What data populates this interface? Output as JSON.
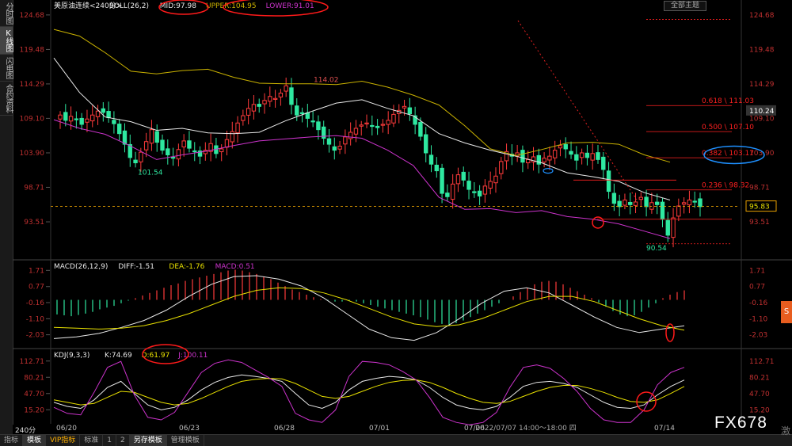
{
  "sidebar": {
    "items": [
      {
        "label": "分时图",
        "active": false
      },
      {
        "label": "K线图",
        "active": true
      },
      {
        "label": "闪电图",
        "active": false
      },
      {
        "label": "合约资料",
        "active": false
      }
    ]
  },
  "header": {
    "dropdown_label": "全部主题"
  },
  "main_legend": {
    "symbol": "美原油连续",
    "period_tag": "<240分>",
    "boll": "BOLL(26,2)",
    "mid": "MID:97.98",
    "upper": "UPPER:104.95",
    "lower": "LOWER:91.01"
  },
  "macd_legend": {
    "name": "MACD(26,12,9)",
    "diff": "DIFF:-1.51",
    "dea": "DEA:-1.76",
    "macd": "MACD:0.51"
  },
  "kdj_legend": {
    "name": "KDJ(9,3,3)",
    "k": "K:74.69",
    "d": "D:61.97",
    "j": "J:100.11"
  },
  "annotations": {
    "high_label": "114.02",
    "low1_label": "101.54",
    "low2_label": "90.54",
    "current_price": "95.83",
    "hover_price": "110.24",
    "timestamp": "2022/07/07 14:00～18:00 四"
  },
  "fib_levels": [
    {
      "ratio": "0.618",
      "price": 111.03,
      "label": "0.618 \\ 111.03"
    },
    {
      "ratio": "0.500",
      "price": 107.1,
      "label": "0.500 \\ 107.10"
    },
    {
      "ratio": "0.382",
      "price": 103.17,
      "label": "0.382 \\ 103.17"
    },
    {
      "ratio": "0.236",
      "price": 98.32,
      "label": "0.236 \\ 98.32"
    }
  ],
  "bottom_tabs": [
    {
      "label": "指标",
      "active": false,
      "vip": false
    },
    {
      "label": "模板",
      "active": true,
      "vip": false
    },
    {
      "label": "VIP指标",
      "active": false,
      "vip": true
    },
    {
      "label": "标准",
      "active": false,
      "vip": false
    },
    {
      "label": "1",
      "active": false,
      "vip": false
    },
    {
      "label": "2",
      "active": false,
      "vip": false
    },
    {
      "label": "另存模板",
      "active": true,
      "vip": false
    },
    {
      "label": "管理模板",
      "active": false,
      "vip": false
    }
  ],
  "period_button": "240分",
  "watermark": "FX678",
  "side_text": "激",
  "side_icon_label": "S",
  "colors": {
    "up": "#ff3b3b",
    "down": "#2ee8a0",
    "mid": "#e8e8e8",
    "upper": "#c9b100",
    "lower": "#cc33cc",
    "fib": "#ff2020",
    "diff": "#e8e8e8",
    "dea": "#e8e000",
    "k": "#e8e8e8",
    "d": "#e8e000",
    "j": "#cc33cc",
    "circle": "#ff1a1a",
    "ellipse_blue": "#1e90ff"
  },
  "chart_data": [
    {
      "type": "candlestick",
      "title": "美原油连续<240分>",
      "x_ticks": [
        "06/20",
        "06/23",
        "06/28",
        "07/01",
        "07/06",
        "07/14"
      ],
      "y_ticks": [
        124.68,
        119.48,
        114.29,
        109.1,
        103.9,
        98.71,
        93.51
      ],
      "ylim": [
        88.5,
        125.5
      ],
      "candles_close": [
        109.6,
        108.8,
        109.4,
        108.9,
        108.2,
        109.0,
        109.6,
        110.2,
        110.0,
        109.2,
        108.3,
        106.8,
        105.2,
        103.2,
        102.4,
        104.0,
        105.6,
        107.4,
        105.5,
        104.3,
        103.6,
        103.1,
        104.4,
        105.7,
        104.6,
        104.1,
        103.4,
        104.3,
        105.3,
        103.8,
        104.5,
        105.9,
        107.1,
        108.4,
        109.5,
        110.6,
        111.2,
        110.9,
        111.8,
        112.4,
        112.1,
        112.9,
        114.0,
        111.2,
        109.6,
        109.8,
        109.1,
        108.6,
        107.4,
        106.1,
        105.2,
        104.3,
        104.9,
        106.3,
        107.0,
        107.6,
        108.1,
        108.4,
        108.0,
        107.7,
        108.2,
        108.8,
        109.7,
        110.3,
        110.9,
        109.8,
        108.2,
        106.4,
        103.9,
        102.2,
        101.2,
        97.8,
        97.3,
        99.2,
        100.6,
        99.8,
        98.4,
        97.9,
        97.4,
        98.9,
        99.6,
        100.4,
        102.6,
        104.1,
        103.4,
        103.9,
        102.5,
        102.9,
        103.3,
        102.2,
        103.1,
        103.4,
        104.3,
        105.0,
        104.5,
        103.7,
        102.8,
        103.9,
        103.2,
        103.8,
        102.9,
        101.4,
        98.1,
        96.3,
        95.8,
        96.8,
        96.1,
        96.5,
        97.2,
        95.8,
        96.4,
        96.1,
        93.9,
        91.5,
        94.1,
        95.9,
        96.4,
        96.8,
        96.6,
        95.8
      ],
      "series": [
        {
          "name": "MID",
          "values": [
            118.2,
            113.0,
            109.3,
            108.6,
            107.3,
            107.6,
            106.9,
            106.8,
            107.0,
            108.7,
            110.1,
            111.4,
            111.9,
            110.6,
            109.5,
            106.8,
            105.4,
            104.3,
            103.4,
            102.4,
            100.9,
            100.3,
            99.6,
            97.9,
            96.8
          ]
        },
        {
          "name": "UPPER",
          "values": [
            122.5,
            121.5,
            119.0,
            116.2,
            115.8,
            116.3,
            116.5,
            115.3,
            114.4,
            114.3,
            114.3,
            114.2,
            114.7,
            113.8,
            112.6,
            111.1,
            108.0,
            104.5,
            103.5,
            104.4,
            105.4,
            105.5,
            105.2,
            103.6,
            102.5
          ]
        },
        {
          "name": "LOWER",
          "values": [
            108.9,
            107.6,
            106.7,
            104.9,
            102.9,
            103.6,
            104.2,
            105.0,
            105.7,
            106.0,
            106.3,
            106.5,
            106.1,
            104.3,
            102.0,
            97.2,
            95.4,
            95.5,
            94.9,
            95.2,
            94.3,
            93.9,
            93.2,
            92.1,
            91.0
          ]
        }
      ]
    },
    {
      "type": "bar",
      "title": "MACD(26,12,9)",
      "y_ticks": [
        1.71,
        0.77,
        -0.16,
        -1.1,
        -2.03
      ],
      "ylim": [
        -2.6,
        2.0
      ],
      "macd_hist": [
        -0.85,
        -0.9,
        -0.95,
        -0.88,
        -0.8,
        -0.7,
        -0.55,
        -0.45,
        -0.35,
        -0.2,
        -0.05,
        0.1,
        0.25,
        0.4,
        0.55,
        0.7,
        0.85,
        0.95,
        1.1,
        1.2,
        1.3,
        1.4,
        1.5,
        1.6,
        1.7,
        1.75,
        1.7,
        1.6,
        1.5,
        1.35,
        1.2,
        1.0,
        0.8,
        0.6,
        0.45,
        0.3,
        0.15,
        0.05,
        -0.05,
        -0.1,
        -0.1,
        -0.05,
        -0.1,
        -0.2,
        -0.3,
        -0.4,
        -0.5,
        -0.6,
        -0.7,
        -0.8,
        -0.9,
        -1.0,
        -1.15,
        -1.3,
        -1.4,
        -1.45,
        -1.35,
        -1.2,
        -1.0,
        -0.8,
        -0.6,
        -0.4,
        -0.2,
        0.0,
        0.2,
        0.45,
        0.7,
        0.9,
        1.05,
        1.1,
        1.05,
        0.9,
        0.7,
        0.5,
        0.3,
        0.1,
        -0.15,
        -0.4,
        -0.65,
        -0.85,
        -0.95,
        -0.9,
        -0.7,
        -0.45,
        -0.2,
        0.1,
        0.3,
        0.45,
        0.55
      ],
      "series": [
        {
          "name": "DIFF",
          "values": [
            -2.25,
            -2.15,
            -1.95,
            -1.6,
            -1.2,
            -0.6,
            0.2,
            0.9,
            1.35,
            1.4,
            1.2,
            0.8,
            0.1,
            -0.8,
            -1.7,
            -2.2,
            -2.35,
            -1.9,
            -1.1,
            -0.2,
            0.5,
            0.7,
            0.4,
            -0.3,
            -1.0,
            -1.6,
            -1.9,
            -1.7,
            -1.51
          ]
        },
        {
          "name": "DEA",
          "values": [
            -1.6,
            -1.65,
            -1.7,
            -1.65,
            -1.5,
            -1.2,
            -0.8,
            -0.3,
            0.2,
            0.55,
            0.7,
            0.65,
            0.4,
            0.0,
            -0.5,
            -1.0,
            -1.4,
            -1.55,
            -1.45,
            -1.1,
            -0.6,
            -0.1,
            0.2,
            0.2,
            -0.1,
            -0.6,
            -1.1,
            -1.5,
            -1.76
          ]
        }
      ]
    },
    {
      "type": "line",
      "title": "KDJ(9,3,3)",
      "y_ticks": [
        112.71,
        80.21,
        47.7,
        15.2
      ],
      "ylim": [
        -5,
        125
      ],
      "series": [
        {
          "name": "K",
          "values": [
            30,
            22,
            18,
            35,
            60,
            72,
            48,
            25,
            15,
            20,
            35,
            55,
            70,
            80,
            85,
            82,
            78,
            72,
            48,
            25,
            18,
            30,
            55,
            72,
            78,
            82,
            80,
            75,
            60,
            40,
            25,
            18,
            15,
            22,
            40,
            62,
            70,
            72,
            68,
            60,
            45,
            30,
            20,
            18,
            25,
            45,
            62,
            74.69
          ]
        },
        {
          "name": "D",
          "values": [
            35,
            30,
            25,
            28,
            40,
            52,
            50,
            40,
            30,
            25,
            28,
            38,
            50,
            62,
            72,
            76,
            78,
            77,
            68,
            55,
            42,
            38,
            42,
            52,
            62,
            70,
            74,
            75,
            70,
            60,
            48,
            38,
            30,
            28,
            32,
            42,
            52,
            60,
            64,
            64,
            58,
            50,
            40,
            32,
            30,
            35,
            48,
            61.97
          ]
        },
        {
          "name": "J",
          "values": [
            20,
            8,
            5,
            50,
            100,
            112,
            45,
            0,
            -5,
            10,
            50,
            90,
            108,
            115,
            110,
            95,
            80,
            62,
            8,
            -5,
            -10,
            15,
            82,
            112,
            110,
            105,
            92,
            75,
            40,
            0,
            -10,
            -15,
            -10,
            10,
            60,
            100,
            105,
            98,
            78,
            52,
            18,
            -5,
            -10,
            -10,
            15,
            65,
            90,
            100.11
          ]
        }
      ]
    }
  ]
}
